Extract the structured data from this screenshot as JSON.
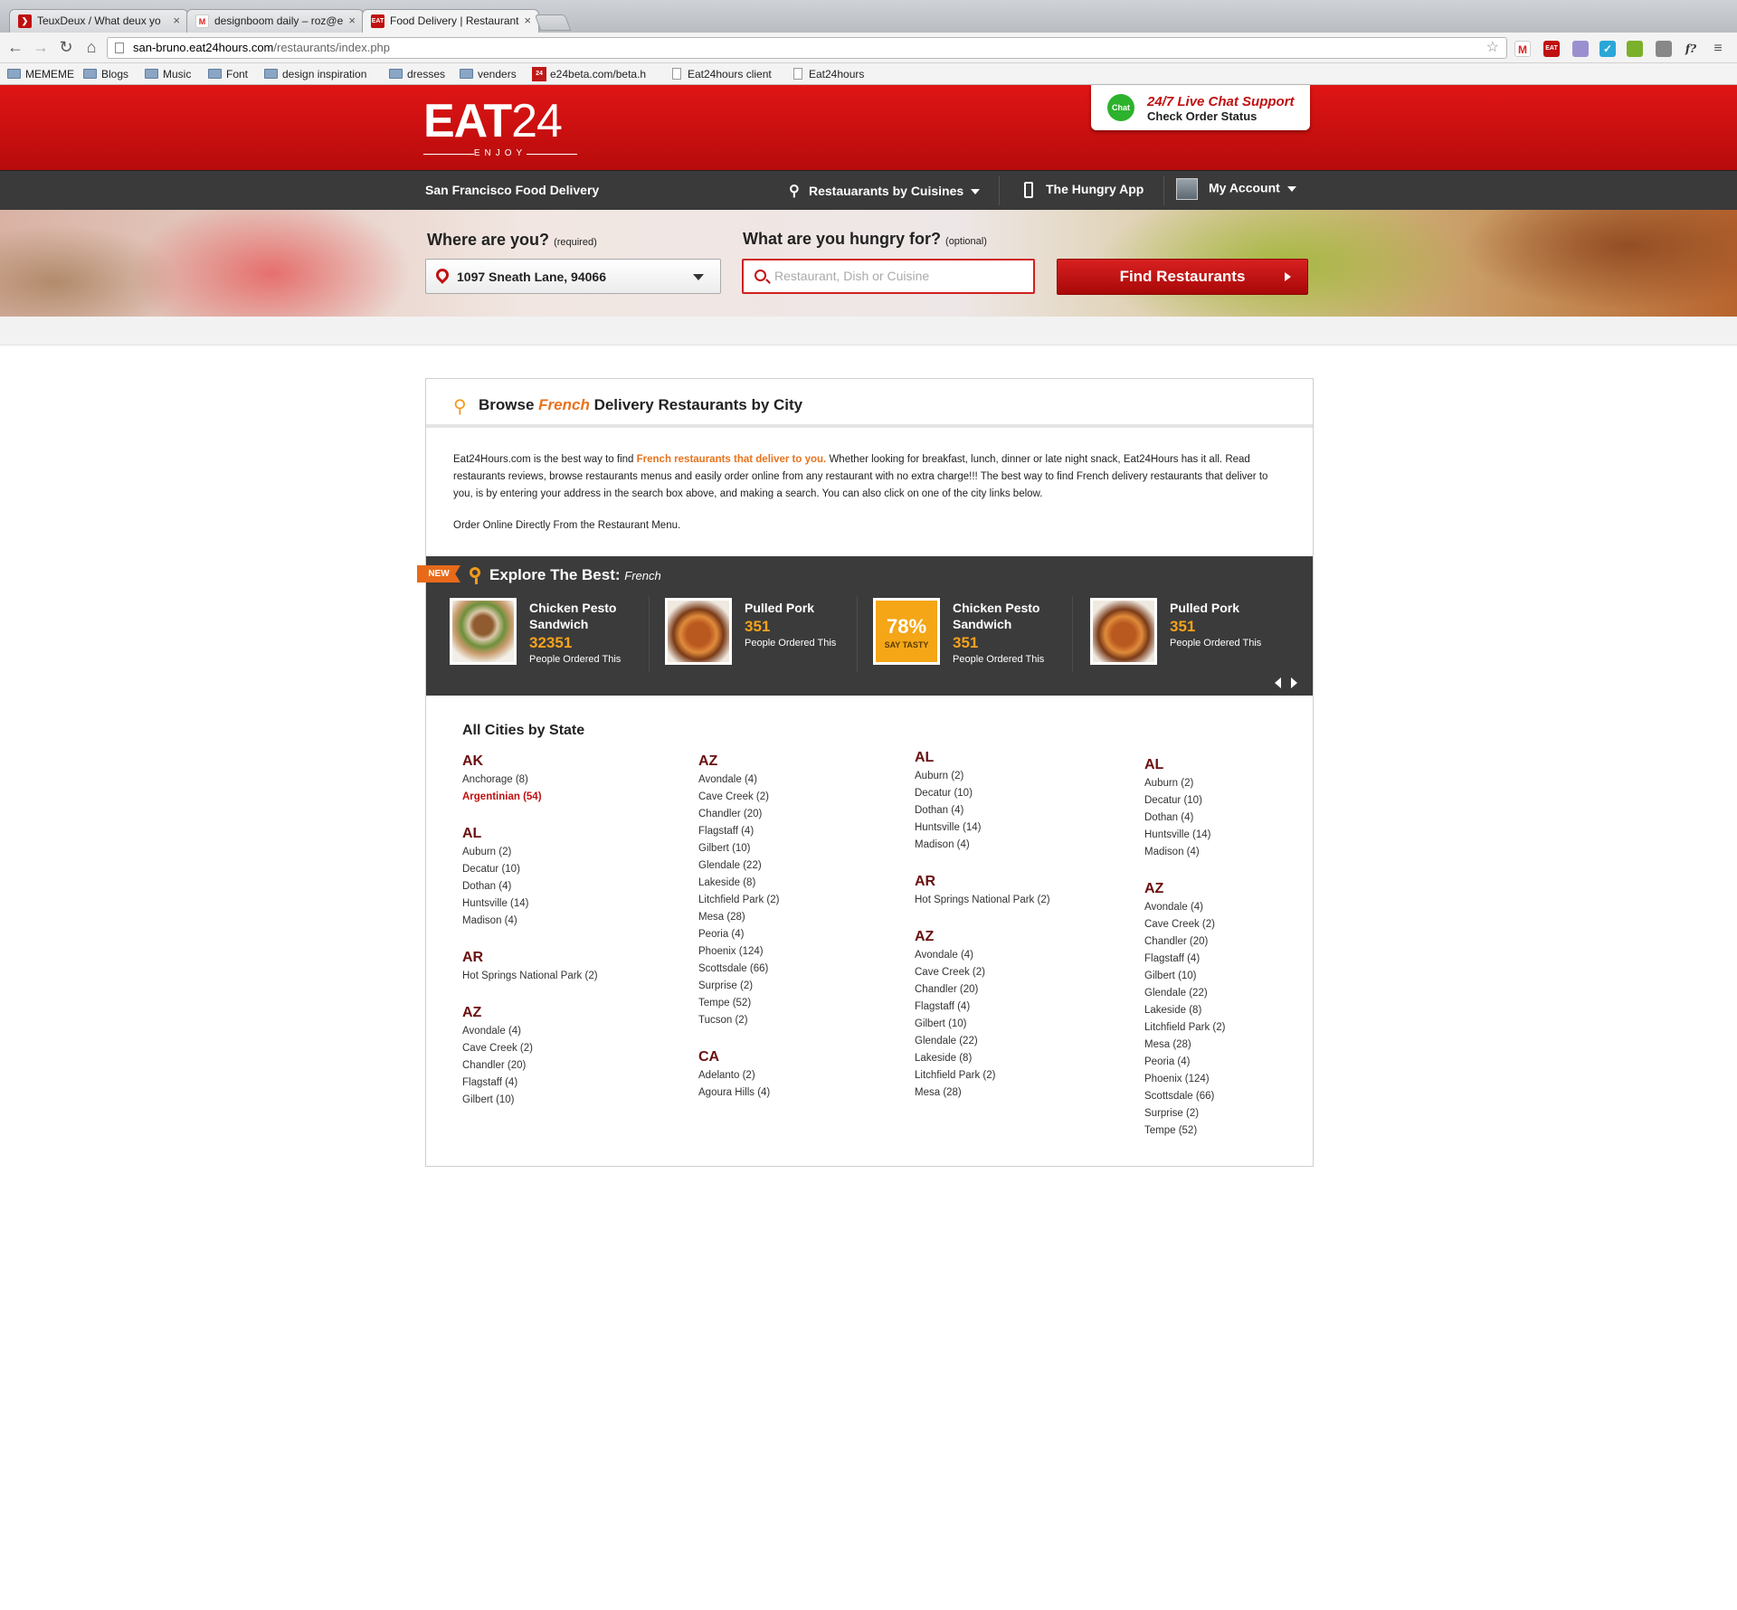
{
  "browser": {
    "tabs": [
      {
        "title": "TeuxDeux / What deux yo"
      },
      {
        "title": "designboom daily – roz@e"
      },
      {
        "title": "Food Delivery | Restaurant"
      }
    ],
    "url_host": "san-bruno.eat24hours.com",
    "url_path": "/restaurants/index.php",
    "bookmarks": [
      {
        "label": "MEMEME"
      },
      {
        "label": "Blogs"
      },
      {
        "label": "Music"
      },
      {
        "label": "Font"
      },
      {
        "label": "design inspiration"
      },
      {
        "label": "dresses"
      },
      {
        "label": "venders"
      },
      {
        "label": "e24beta.com/beta.h"
      },
      {
        "label": "Eat24hours client"
      },
      {
        "label": "Eat24hours"
      }
    ]
  },
  "header": {
    "logo_main": "EAT",
    "logo_num": "24",
    "logo_sub": "ENJOY",
    "chat_icon": "Chat",
    "chat_line1": "24/7 Live Chat Support",
    "chat_line2": "Check Order Status"
  },
  "nav": {
    "title": "San Francisco Food Delivery",
    "cuisines": "Restauarants by Cuisines",
    "app": "The Hungry App",
    "account": "My Account"
  },
  "search": {
    "where_label": "Where are you?",
    "where_hint": "(required)",
    "what_label": "What are you hungry for?",
    "what_hint": "(optional)",
    "location": "1097 Sneath Lane, 94066",
    "placeholder": "Restaurant, Dish or Cuisine",
    "button": "Find Restaurants"
  },
  "card": {
    "title_pre": "Browse",
    "title_cuisine": "French",
    "title_post": "Delivery Restaurants by City",
    "intro_1": "Eat24Hours.com is the best way to find",
    "intro_hl": "French restaurants that deliver to you.",
    "intro_2": "Whether looking for breakfast, lunch, dinner or late night snack, Eat24Hours has it all. Read restaurants reviews, browse restaurants menus and easily order online from any restaurant with no extra charge!!! The best way to find French delivery restaurants that deliver to you, is by entering your address in the search box above, and making a search. You can also click on one of the city links below.",
    "intro_3": "Order Online Directly From the Restaurant Menu."
  },
  "explore": {
    "badge": "NEW",
    "title": "Explore The Best:",
    "cuisine": "French",
    "items": [
      {
        "name": "Chicken Pesto Sandwich",
        "count": "32351",
        "sub": "People Ordered This"
      },
      {
        "name": "Pulled Pork",
        "count": "351",
        "sub": "People Ordered This"
      },
      {
        "name": "Chicken Pesto Sandwich",
        "count": "351",
        "sub": "People Ordered This",
        "pct": "78%",
        "pct_label": "SAY TASTY"
      },
      {
        "name": "Pulled Pork",
        "count": "351",
        "sub": "People Ordered This"
      }
    ]
  },
  "cities": {
    "title": "All Cities by State",
    "columns": [
      [
        {
          "state": "AK",
          "cities": [
            "Anchorage (8)",
            "Argentinian (54)"
          ]
        },
        {
          "state": "AL",
          "cities": [
            "Auburn (2)",
            "Decatur (10)",
            "Dothan (4)",
            "Huntsville (14)",
            "Madison (4)"
          ]
        },
        {
          "state": "AR",
          "cities": [
            "Hot Springs National Park (2)"
          ]
        },
        {
          "state": "AZ",
          "cities": [
            "Avondale (4)",
            "Cave Creek (2)",
            "Chandler (20)",
            "Flagstaff (4)",
            "Gilbert (10)"
          ]
        }
      ],
      [
        {
          "state": "AZ",
          "cities": [
            "Avondale (4)",
            "Cave Creek (2)",
            "Chandler (20)",
            "Flagstaff (4)",
            "Gilbert (10)",
            "Glendale (22)",
            "Lakeside (8)",
            "Litchfield Park (2)",
            "Mesa (28)",
            "Peoria (4)",
            "Phoenix (124)",
            "Scottsdale (66)",
            "Surprise (2)",
            "Tempe (52)",
            "Tucson (2)"
          ]
        },
        {
          "state": "CA",
          "cities": [
            "Adelanto (2)",
            "Agoura Hills (4)"
          ]
        }
      ],
      [
        {
          "state": "AL",
          "cities": [
            "Auburn (2)",
            "Decatur (10)",
            "Dothan (4)",
            "Huntsville (14)",
            "Madison (4)"
          ]
        },
        {
          "state": "AR",
          "cities": [
            "Hot Springs National Park (2)"
          ]
        },
        {
          "state": "AZ",
          "cities": [
            "Avondale (4)",
            "Cave Creek (2)",
            "Chandler (20)",
            "Flagstaff (4)",
            "Gilbert (10)",
            "Glendale (22)",
            "Lakeside (8)",
            "Litchfield Park (2)",
            "Mesa (28)"
          ]
        }
      ],
      [
        {
          "state": "AL",
          "cities": [
            "Auburn (2)",
            "Decatur (10)",
            "Dothan (4)",
            "Huntsville (14)",
            "Madison (4)"
          ]
        },
        {
          "state": "AZ",
          "cities": [
            "Avondale (4)",
            "Cave Creek (2)",
            "Chandler (20)",
            "Flagstaff (4)",
            "Gilbert (10)",
            "Glendale (22)",
            "Lakeside (8)",
            "Litchfield Park (2)",
            "Mesa (28)",
            "Peoria (4)",
            "Phoenix (124)",
            "Scottsdale (66)",
            "Surprise (2)",
            "Tempe (52)"
          ]
        }
      ]
    ]
  }
}
